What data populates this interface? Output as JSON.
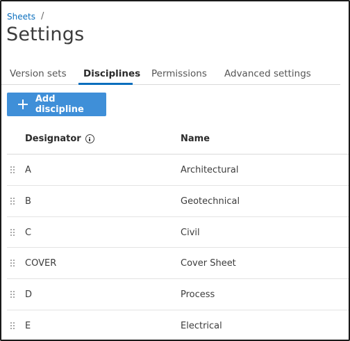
{
  "breadcrumb": {
    "parent": "Sheets",
    "separator": "/"
  },
  "page": {
    "title": "Settings"
  },
  "tabs": [
    {
      "label": "Version sets",
      "active": false
    },
    {
      "label": "Disciplines",
      "active": true
    },
    {
      "label": "Permissions",
      "active": false
    },
    {
      "label": "Advanced settings",
      "active": false
    }
  ],
  "actions": {
    "add_label": "Add discipline",
    "add_icon": "plus-icon"
  },
  "table": {
    "columns": {
      "designator": "Designator",
      "name": "Name",
      "designator_icon": "info-icon"
    },
    "rows": [
      {
        "designator": "A",
        "name": "Architectural"
      },
      {
        "designator": "B",
        "name": "Geotechnical"
      },
      {
        "designator": "C",
        "name": "Civil"
      },
      {
        "designator": "COVER",
        "name": "Cover Sheet"
      },
      {
        "designator": "D",
        "name": "Process"
      },
      {
        "designator": "E",
        "name": "Electrical"
      }
    ]
  },
  "colors": {
    "accent": "#0a6ebd",
    "button": "#3f8fd8",
    "text": "#3c3c3c",
    "divider": "#d9d9d9"
  }
}
